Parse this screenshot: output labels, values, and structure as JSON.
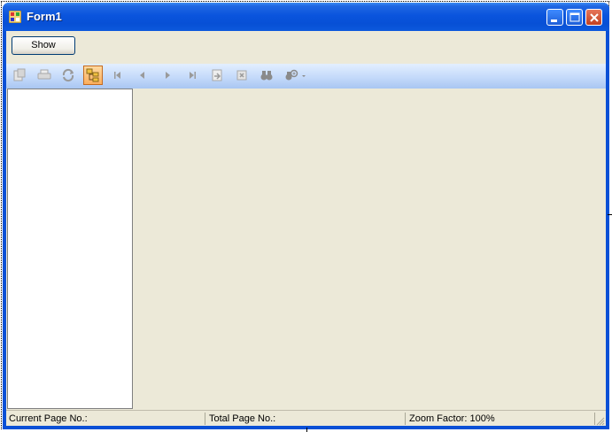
{
  "window": {
    "title": "Form1"
  },
  "controls": {
    "show_label": "Show"
  },
  "toolbar": {
    "buttons": [
      {
        "name": "export-icon"
      },
      {
        "name": "print-icon"
      },
      {
        "name": "refresh-icon"
      },
      {
        "name": "toggle-tree-icon",
        "active": true
      },
      {
        "name": "first-page-icon"
      },
      {
        "name": "previous-page-icon"
      },
      {
        "name": "next-page-icon"
      },
      {
        "name": "last-page-icon"
      },
      {
        "name": "goto-page-icon"
      },
      {
        "name": "stop-icon"
      },
      {
        "name": "find-icon"
      },
      {
        "name": "zoom-icon"
      }
    ]
  },
  "statusbar": {
    "current_page": "Current Page No.:",
    "total_page": "Total Page No.:",
    "zoom": "Zoom Factor: 100%"
  },
  "colors": {
    "titlebar": "#0a54dd",
    "client_bg": "#ece9d8",
    "toolbar": "#c4dafa",
    "active_button": "#fbae5d",
    "close_button": "#c3401f"
  }
}
